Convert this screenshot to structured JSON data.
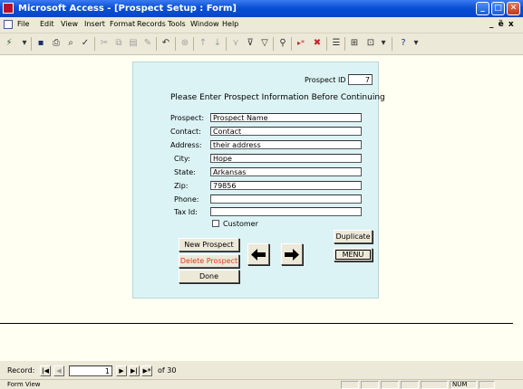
{
  "window": {
    "title": "Microsoft Access - [Prospect Setup : Form]"
  },
  "menu": [
    "File",
    "Edit",
    "View",
    "Insert",
    "Format",
    "Records",
    "Tools",
    "Window",
    "Help"
  ],
  "mdi_controls": "_ ȅ x",
  "toolbar_icons": [
    "view-icon",
    "save-icon",
    "print-icon",
    "print-preview-icon",
    "spelling-icon",
    "cut-icon",
    "copy-icon",
    "paste-icon",
    "format-painter-icon",
    "undo-icon",
    "insert-hyperlink-icon",
    "sort-ascending-icon",
    "sort-descending-icon",
    "filter-by-selection-icon",
    "filter-by-form-icon",
    "apply-filter-icon",
    "find-icon",
    "new-record-icon",
    "delete-record-icon",
    "properties-icon",
    "database-window-icon",
    "new-object-icon",
    "help-icon"
  ],
  "form": {
    "prospect_id_label": "Prospect ID",
    "prospect_id_value": "7",
    "heading": "Please Enter Prospect Information Before Continuing",
    "fields": [
      {
        "label": "Prospect:",
        "value": "Prospect Name"
      },
      {
        "label": "Contact:",
        "value": "Contact"
      },
      {
        "label": "Address:",
        "value": "their address"
      },
      {
        "label": "City:",
        "value": "Hope"
      },
      {
        "label": "State:",
        "value": "Arkansas"
      },
      {
        "label": "Zip:",
        "value": "79856"
      },
      {
        "label": "Phone:",
        "value": ""
      },
      {
        "label": "Tax Id:",
        "value": ""
      }
    ],
    "customer_label": "Customer",
    "customer_checked": false,
    "buttons": {
      "new_prospect": "New Prospect",
      "delete_prospect": "Delete Prospect",
      "done": "Done",
      "duplicate": "Duplicate",
      "menu": "MENU"
    },
    "colors": {
      "panel": "#dcf3f5",
      "delete_text": "#e03a1e"
    }
  },
  "record_nav": {
    "label": "Record:",
    "current": "1",
    "total_text": "of 30"
  },
  "status": {
    "text": "Form View",
    "num": "NUM"
  }
}
